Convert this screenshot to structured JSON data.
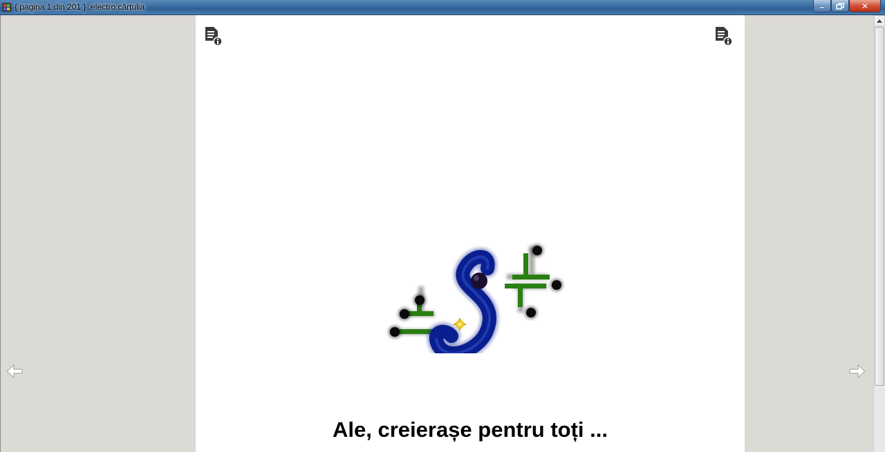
{
  "window": {
    "title": "{ pagina 1 din 201 } .electro:cărțulia",
    "icon": "app-cube-icon",
    "controls": {
      "minimize": "minimize-icon",
      "maximize": "restore-icon",
      "close_label": "✕"
    }
  },
  "page": {
    "info_icon": "document-info-icon",
    "logo": "electro-s-circuit-logo",
    "headline": "Ale, creierașe pentru toți ..."
  },
  "navigation": {
    "prev_icon": "arrow-left-icon",
    "next_icon": "arrow-right-icon"
  },
  "colors": {
    "page_bg": "#ffffff",
    "window_bg": "#dcdad5",
    "logo_blue": "#0a1f8f",
    "logo_green": "#2a7f12"
  }
}
